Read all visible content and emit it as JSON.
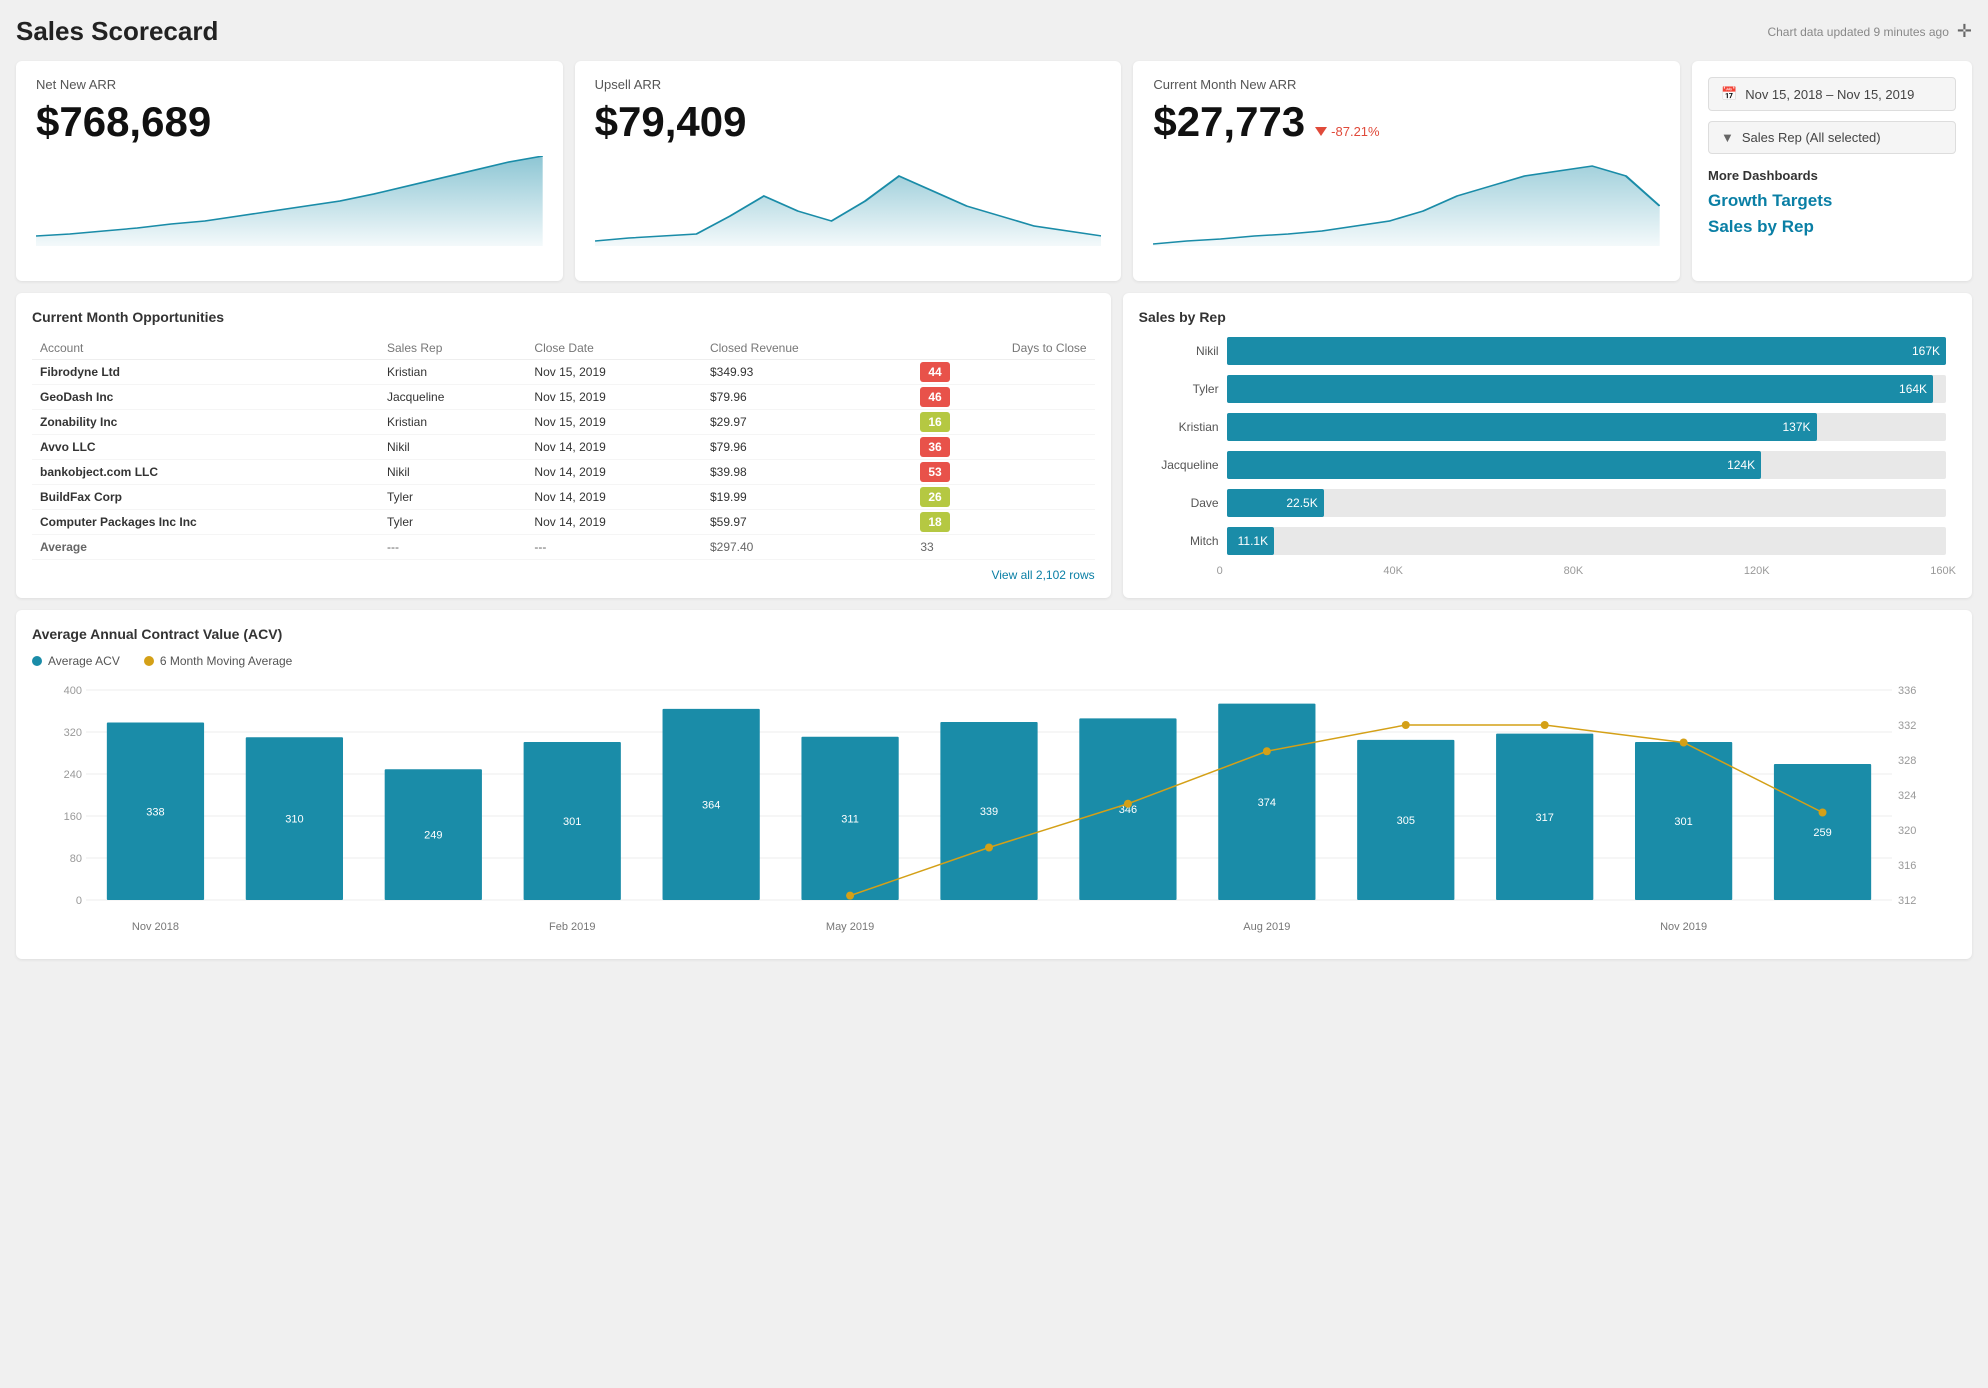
{
  "header": {
    "title": "Sales Scorecard",
    "updated_text": "Chart data updated 9 minutes ago"
  },
  "filters": {
    "date_range": "Nov 15, 2018  –  Nov 15, 2019",
    "sales_rep": "Sales Rep (All selected)"
  },
  "kpis": [
    {
      "label": "Net New ARR",
      "value": "$768,689",
      "badge": null
    },
    {
      "label": "Upsell ARR",
      "value": "$79,409",
      "badge": null
    },
    {
      "label": "Current Month New ARR",
      "value": "$27,773",
      "badge": "-87.21%",
      "badge_type": "negative"
    }
  ],
  "more_dashboards": {
    "label": "More Dashboards",
    "links": [
      "Growth Targets",
      "Sales by Rep"
    ]
  },
  "opportunities_table": {
    "title": "Current Month Opportunities",
    "columns": [
      "Account",
      "Sales Rep",
      "Close Date",
      "Closed Revenue",
      "Days to Close"
    ],
    "rows": [
      {
        "account": "Fibrodyne Ltd",
        "rep": "Kristian",
        "close_date": "Nov 15, 2019",
        "revenue": "$349.93",
        "days": "44",
        "days_color": "red"
      },
      {
        "account": "GeoDash Inc",
        "rep": "Jacqueline",
        "close_date": "Nov 15, 2019",
        "revenue": "$79.96",
        "days": "46",
        "days_color": "red"
      },
      {
        "account": "Zonability Inc",
        "rep": "Kristian",
        "close_date": "Nov 15, 2019",
        "revenue": "$29.97",
        "days": "16",
        "days_color": "green"
      },
      {
        "account": "Avvo LLC",
        "rep": "Nikil",
        "close_date": "Nov 14, 2019",
        "revenue": "$79.96",
        "days": "36",
        "days_color": "red"
      },
      {
        "account": "bankobject.com LLC",
        "rep": "Nikil",
        "close_date": "Nov 14, 2019",
        "revenue": "$39.98",
        "days": "53",
        "days_color": "red"
      },
      {
        "account": "BuildFax Corp",
        "rep": "Tyler",
        "close_date": "Nov 14, 2019",
        "revenue": "$19.99",
        "days": "26",
        "days_color": "green"
      },
      {
        "account": "Computer Packages Inc Inc",
        "rep": "Tyler",
        "close_date": "Nov 14, 2019",
        "revenue": "$59.97",
        "days": "18",
        "days_color": "green"
      }
    ],
    "avg_row": {
      "label": "Average",
      "rep": "---",
      "date": "---",
      "revenue": "$297.40",
      "days": "33"
    },
    "view_all": "View all 2,102 rows"
  },
  "sales_by_rep": {
    "title": "Sales by Rep",
    "bars": [
      {
        "label": "Nikil",
        "value": 167,
        "display": "167K",
        "pct": 100
      },
      {
        "label": "Tyler",
        "value": 164,
        "display": "164K",
        "pct": 98.2
      },
      {
        "label": "Kristian",
        "value": 137,
        "display": "137K",
        "pct": 82
      },
      {
        "label": "Jacqueline",
        "value": 124,
        "display": "124K",
        "pct": 74.3
      },
      {
        "label": "Dave",
        "value": 22.5,
        "display": "22.5K",
        "pct": 13.5
      },
      {
        "label": "Mitch",
        "value": 11.1,
        "display": "11.1K",
        "pct": 6.6
      }
    ],
    "x_labels": [
      "0",
      "40K",
      "80K",
      "120K",
      "160K"
    ]
  },
  "acv_chart": {
    "title": "Average Annual Contract Value (ACV)",
    "legend": {
      "avg_acv": "Average ACV",
      "moving_avg": "6 Month Moving Average"
    },
    "bars": [
      {
        "month": "Nov 2018",
        "value": 338,
        "height_pct": 90
      },
      {
        "month": "",
        "value": 310,
        "height_pct": 82
      },
      {
        "month": "",
        "value": 249,
        "height_pct": 66
      },
      {
        "month": "Feb 2019",
        "value": 301,
        "height_pct": 80
      },
      {
        "month": "",
        "value": 364,
        "height_pct": 97
      },
      {
        "month": "May 2019",
        "value": 311,
        "height_pct": 83
      },
      {
        "month": "",
        "value": 339,
        "height_pct": 90
      },
      {
        "month": "",
        "value": 346,
        "height_pct": 92
      },
      {
        "month": "Aug 2019",
        "value": 374,
        "height_pct": 99.5
      },
      {
        "month": "",
        "value": 305,
        "height_pct": 81
      },
      {
        "month": "",
        "value": 317,
        "height_pct": 84
      },
      {
        "month": "Nov 2019",
        "value": 301,
        "height_pct": 80
      },
      {
        "month": "",
        "value": 259,
        "height_pct": 69
      }
    ],
    "y_labels_left": [
      "320",
      "240",
      "160",
      "80",
      "0"
    ],
    "y_labels_right": [
      "336",
      "332",
      "328",
      "324",
      "320",
      "316",
      "312"
    ],
    "x_labels": [
      "Nov 2018",
      "Feb 2019",
      "May 2019",
      "Aug 2019",
      "Nov 2019"
    ]
  }
}
